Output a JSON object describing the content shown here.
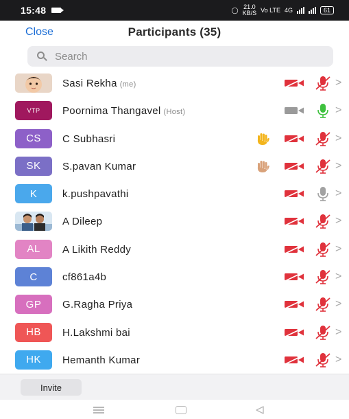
{
  "status_bar": {
    "time": "15:48",
    "net_speed": "21.0",
    "net_unit": "KB/S",
    "volte": "Vo LTE",
    "signal_label": "4G",
    "battery": "61"
  },
  "header": {
    "close_label": "Close",
    "title": "Participants (35)"
  },
  "search": {
    "placeholder": "Search"
  },
  "participants": [
    {
      "initials": "",
      "avatar_type": "photo-child",
      "name": "Sasi Rekha",
      "tag": "(me)",
      "hand": "",
      "video": "off",
      "mic": "muted",
      "color": ""
    },
    {
      "initials": "VTP",
      "avatar_type": "initials",
      "name": "Poornima Thangavel",
      "tag": "(Host)",
      "hand": "",
      "video": "on",
      "mic": "active",
      "color": "#a0185e"
    },
    {
      "initials": "CS",
      "avatar_type": "initials",
      "name": "C Subhasri",
      "tag": "",
      "hand": "yellow",
      "video": "off",
      "mic": "muted",
      "color": "#8d60c8"
    },
    {
      "initials": "SK",
      "avatar_type": "initials",
      "name": "S.pavan Kumar",
      "tag": "",
      "hand": "tan",
      "video": "off",
      "mic": "muted",
      "color": "#7b6fc6"
    },
    {
      "initials": "K",
      "avatar_type": "initials",
      "name": "k.pushpavathi",
      "tag": "",
      "hand": "",
      "video": "off",
      "mic": "gray",
      "color": "#4aa8ec"
    },
    {
      "initials": "",
      "avatar_type": "photo-duo",
      "name": "A Dileep",
      "tag": "",
      "hand": "",
      "video": "off",
      "mic": "muted",
      "color": ""
    },
    {
      "initials": "AL",
      "avatar_type": "initials",
      "name": "A Likith Reddy",
      "tag": "",
      "hand": "",
      "video": "off",
      "mic": "muted",
      "color": "#e284c4"
    },
    {
      "initials": "C",
      "avatar_type": "initials",
      "name": "cf861a4b",
      "tag": "",
      "hand": "",
      "video": "off",
      "mic": "muted",
      "color": "#5d82d6"
    },
    {
      "initials": "GP",
      "avatar_type": "initials",
      "name": "G.Ragha Priya",
      "tag": "",
      "hand": "",
      "video": "off",
      "mic": "muted",
      "color": "#d76fbe"
    },
    {
      "initials": "HB",
      "avatar_type": "initials",
      "name": "H.Lakshmi bai",
      "tag": "",
      "hand": "",
      "video": "off",
      "mic": "muted",
      "color": "#ef5656"
    },
    {
      "initials": "HK",
      "avatar_type": "initials",
      "name": "Hemanth Kumar",
      "tag": "",
      "hand": "",
      "video": "off",
      "mic": "muted",
      "color": "#3fa9ef"
    }
  ],
  "footer": {
    "invite_label": "Invite"
  },
  "colors": {
    "accent": "#1e6fd6",
    "muted_red": "#e0323c",
    "mic_green": "#3ec13e",
    "neutral_gray": "#9a9a9a"
  }
}
